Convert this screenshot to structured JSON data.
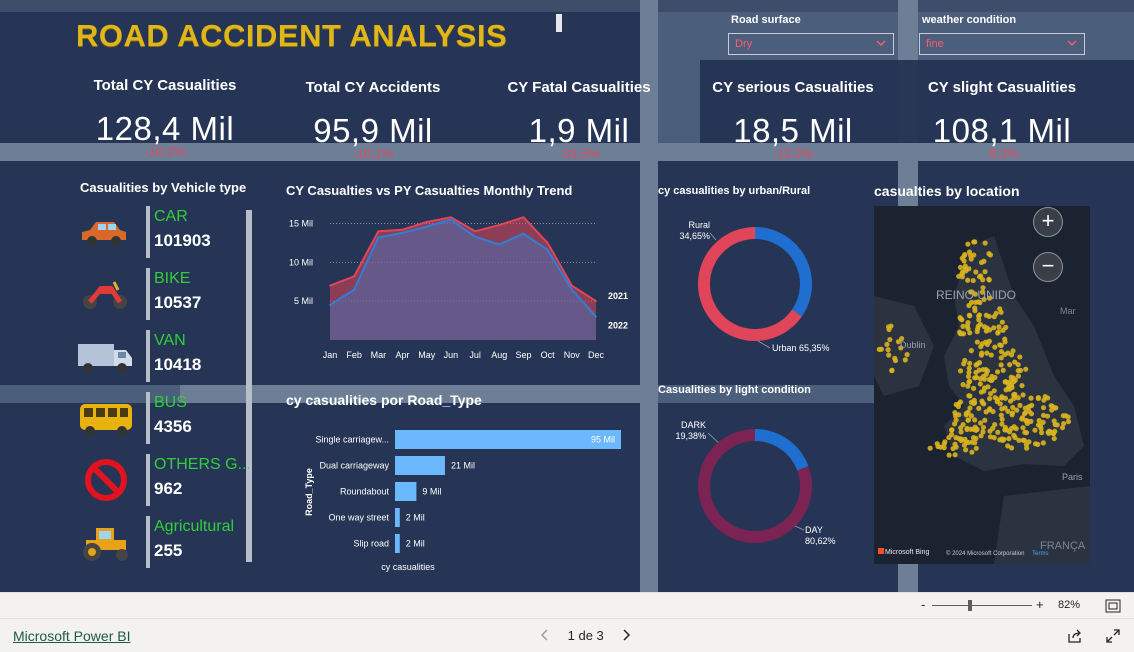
{
  "report": {
    "title": "ROAD ACCIDENT ANALYSIS"
  },
  "slicers": [
    {
      "label": "Road surface",
      "value": "Dry"
    },
    {
      "label": "weather condition",
      "value": "fine"
    }
  ],
  "kpis": [
    {
      "title": "Total CY Casualities",
      "value": "128,4 Mil",
      "delta": "-10,2%"
    },
    {
      "title": "Total CY Accidents",
      "value": "95,9 Mil",
      "delta": "-10,1%"
    },
    {
      "title": "CY Fatal Casualities",
      "value": "1,9 Mil",
      "delta": "-33,5%"
    },
    {
      "title": "CY serious Casualities",
      "value": "18,5 Mil",
      "delta": "-12,2%"
    },
    {
      "title": "CY slight Casualities",
      "value": "108,1 Mil",
      "delta": "-9,3%"
    }
  ],
  "vehicle_panel": {
    "title": "Casualities by Vehicle type",
    "items": [
      {
        "name": "CAR",
        "value": "101903",
        "icon": "car-icon"
      },
      {
        "name": "BIKE",
        "value": "10537",
        "icon": "motorbike-icon"
      },
      {
        "name": "VAN",
        "value": "10418",
        "icon": "van-icon"
      },
      {
        "name": "BUS",
        "value": "4356",
        "icon": "bus-icon"
      },
      {
        "name": "OTHERS G...",
        "value": "962",
        "icon": "prohibited-icon"
      },
      {
        "name": "Agricultural",
        "value": "255",
        "icon": "tractor-icon"
      }
    ]
  },
  "charts": {
    "monthly_title": "CY Casualties vs PY Casualties Monthly Trend",
    "road_type_title": "cy casualities por Road_Type",
    "urban_title": "cy casualities by urban/Rural",
    "light_title": "Casualities by light condition",
    "map_title": "casualties by location"
  },
  "chart_data": [
    {
      "type": "area",
      "title": "CY Casualties vs PY Casualties Monthly Trend",
      "categories": [
        "Jan",
        "Feb",
        "Mar",
        "Apr",
        "May",
        "Jun",
        "Jul",
        "Aug",
        "Sep",
        "Oct",
        "Nov",
        "Dec"
      ],
      "yticks": [
        "5 Mil",
        "10 Mil",
        "15 Mil"
      ],
      "ylim": [
        0,
        17
      ],
      "series": [
        {
          "name": "2021",
          "color": "#e0455a",
          "values": [
            7.0,
            8.2,
            14.0,
            14.2,
            15.2,
            15.8,
            14.0,
            14.8,
            15.8,
            12.5,
            7.0,
            5.0
          ]
        },
        {
          "name": "2022",
          "color": "#2f7fd6",
          "values": [
            4.5,
            6.5,
            13.2,
            13.8,
            14.6,
            15.5,
            13.3,
            12.3,
            13.7,
            11.6,
            6.5,
            3.0
          ]
        }
      ]
    },
    {
      "type": "bar",
      "title": "cy casualities por Road_Type",
      "ylabel": "Road_Type",
      "xlabel": "cy casualities",
      "categories": [
        "Single carriagew...",
        "Dual carriageway",
        "Roundabout",
        "One way street",
        "Slip road"
      ],
      "values": [
        95,
        21,
        9,
        2,
        2
      ],
      "labels": [
        "95 Mil",
        "21 Mil",
        "9 Mil",
        "2 Mil",
        "2 Mil"
      ],
      "color": "#6cb8ff"
    },
    {
      "type": "pie",
      "title": "cy casualities by urban/Rural",
      "slices": [
        {
          "name": "Rural",
          "label": "34,65%",
          "value": 34.65,
          "color": "#1f6fd1"
        },
        {
          "name": "Urban",
          "label": "65,35%",
          "value": 65.35,
          "color": "#e0455a"
        }
      ]
    },
    {
      "type": "pie",
      "title": "Casualities by light condition",
      "slices": [
        {
          "name": "DARK",
          "label": "19,38%",
          "value": 19.38,
          "color": "#1f6fd1"
        },
        {
          "name": "DAY",
          "label": "80,62%",
          "value": 80.62,
          "color": "#7b2352"
        }
      ]
    }
  ],
  "map": {
    "labels": [
      "REINO UNIDO",
      "Dublin",
      "Mar",
      "Paris",
      "FRANÇA"
    ],
    "attribution": "© 2024 Microsoft Corporation",
    "terms": "Terms",
    "brand": "Microsoft Bing",
    "dot_color": "#d9b21f"
  },
  "footer": {
    "zoom_minus": "-",
    "zoom_plus": "+",
    "zoom_value": "82%",
    "brand_link": "Microsoft Power BI",
    "page_indicator": "1 de 3"
  }
}
